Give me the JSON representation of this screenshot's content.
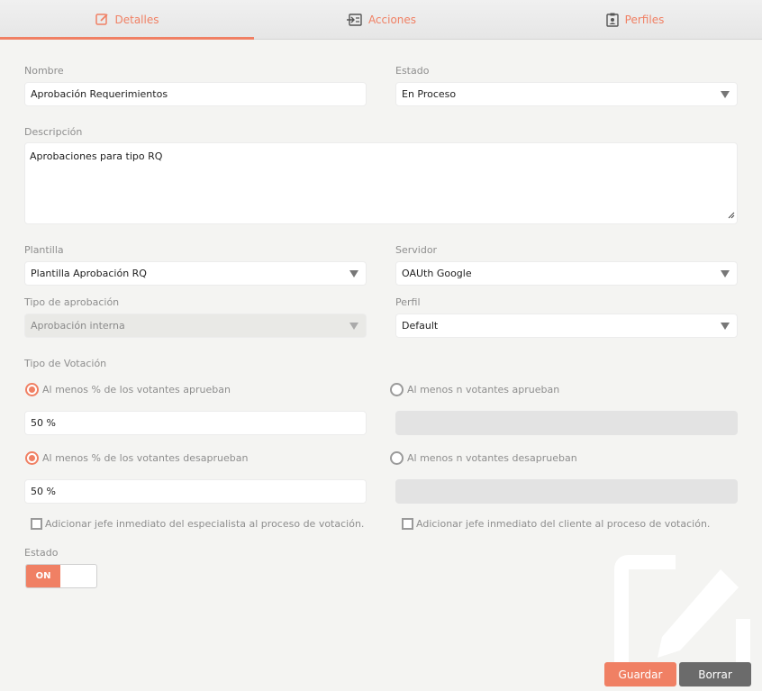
{
  "tabs": [
    {
      "label": "Detalles",
      "icon": "edit-icon",
      "active": true
    },
    {
      "label": "Acciones",
      "icon": "login-icon",
      "active": false
    },
    {
      "label": "Perfiles",
      "icon": "badge-icon",
      "active": false
    }
  ],
  "form": {
    "nombre": {
      "label": "Nombre",
      "value": "Aprobación Requerimientos"
    },
    "estado_select": {
      "label": "Estado",
      "value": "En Proceso"
    },
    "descripcion": {
      "label": "Descripción",
      "value": "Aprobaciones para tipo RQ"
    },
    "plantilla": {
      "label": "Plantilla",
      "value": "Plantilla Aprobación RQ"
    },
    "servidor": {
      "label": "Servidor",
      "value": "OAUth Google"
    },
    "tipo_aprobacion": {
      "label": "Tipo de aprobación",
      "value": "Aprobación interna"
    },
    "perfil": {
      "label": "Perfil",
      "value": "Default"
    },
    "tipo_votacion": {
      "label": "Tipo de Votación",
      "aprueban_pct": {
        "label": "Al menos % de los votantes aprueban",
        "selected": true,
        "value": "50 %"
      },
      "aprueban_n": {
        "label": "Al menos n votantes aprueban",
        "selected": false,
        "value": ""
      },
      "desaprueban_pct": {
        "label": "Al menos % de los votantes desaprueban",
        "selected": true,
        "value": "50 %"
      },
      "desaprueban_n": {
        "label": "Al menos n votantes desaprueban",
        "selected": false,
        "value": ""
      }
    },
    "check_especialista": {
      "label": "Adicionar jefe inmediato del especialista al proceso de votación.",
      "checked": false
    },
    "check_cliente": {
      "label": "Adicionar jefe inmediato del cliente al proceso de votación.",
      "checked": false
    },
    "estado_toggle": {
      "label": "Estado",
      "value": "ON"
    }
  },
  "buttons": {
    "save": "Guardar",
    "delete": "Borrar"
  },
  "colors": {
    "accent": "#f08064",
    "delete": "#6b6b6b",
    "background": "#f4f4f2"
  }
}
